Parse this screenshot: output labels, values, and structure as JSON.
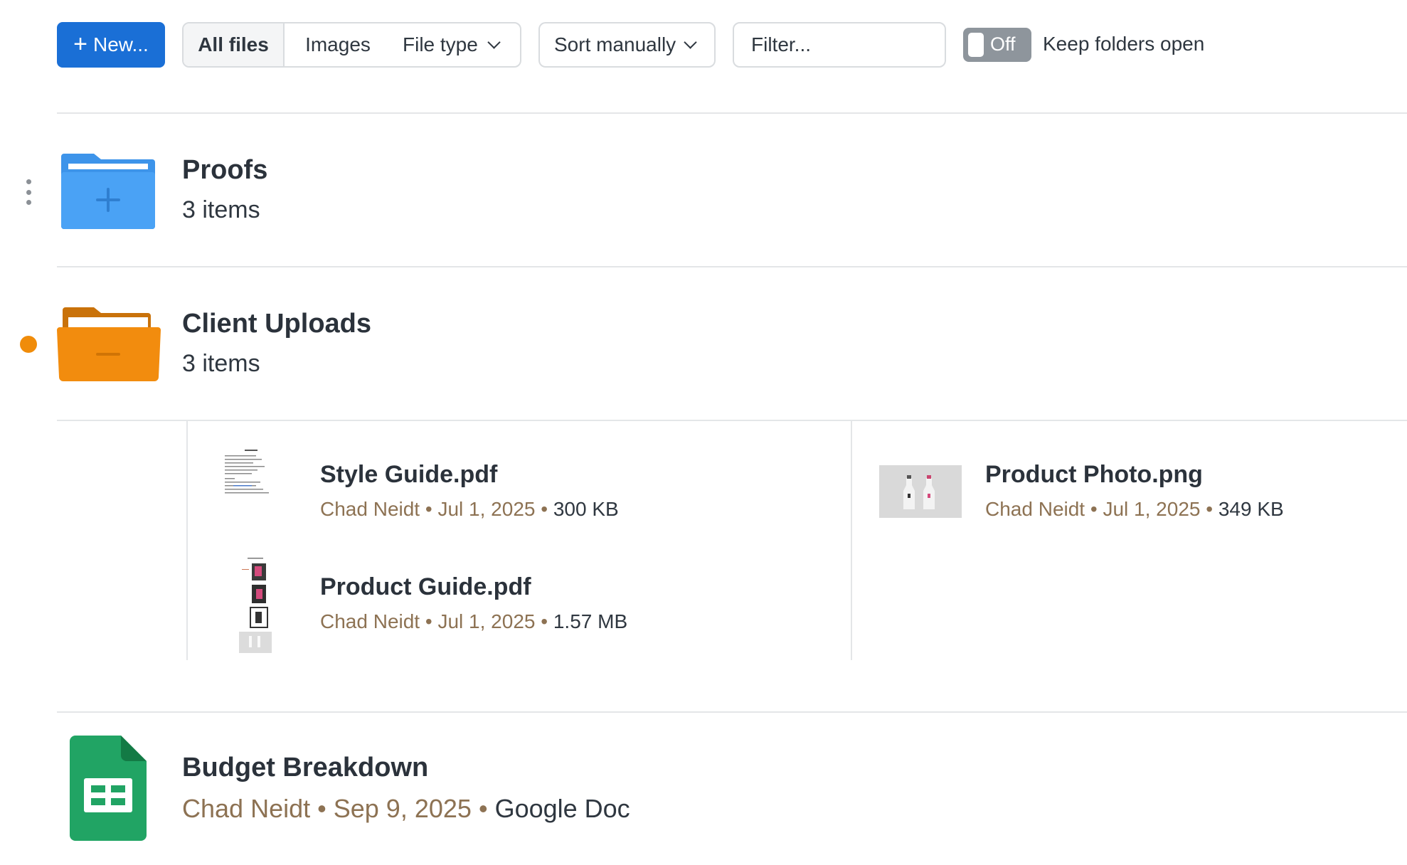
{
  "toolbar": {
    "new_label": "New...",
    "segments": {
      "all": "All files",
      "images": "Images",
      "type": "File type"
    },
    "sort_label": "Sort manually",
    "filter_placeholder": "Filter...",
    "toggle_state": "Off",
    "toggle_label": "Keep folders open"
  },
  "folders": [
    {
      "name": "Proofs",
      "count": "3 items",
      "color": "#3d94ea"
    },
    {
      "name": "Client Uploads",
      "count": "3 items",
      "color": "#f08c0a",
      "unread_dot_color": "#f08c0a"
    }
  ],
  "client_uploads_files": [
    {
      "name": "Style Guide.pdf",
      "author": "Chad Neidt",
      "date": "Jul 1, 2025",
      "size": "300 KB"
    },
    {
      "name": "Product Photo.png",
      "author": "Chad Neidt",
      "date": "Jul 1, 2025",
      "size": "349 KB"
    },
    {
      "name": "Product Guide.pdf",
      "author": "Chad Neidt",
      "date": "Jul 1, 2025",
      "size": "1.57 MB"
    }
  ],
  "docs": [
    {
      "name": "Budget Breakdown",
      "author": "Chad Neidt",
      "date": "Sep 9, 2025",
      "kind": "Google Doc",
      "icon": "google-sheets-icon",
      "color": "#21a464"
    }
  ],
  "separator": "•",
  "colors": {
    "accent": "#1a6fd6",
    "meta": "#8d7253"
  }
}
